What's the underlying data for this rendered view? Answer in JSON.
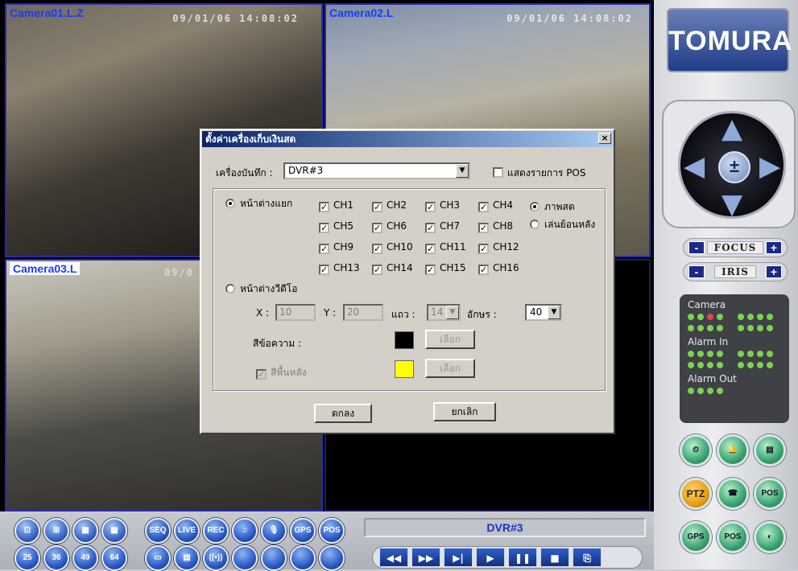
{
  "cameras": [
    {
      "label": "Camera01.L.Z",
      "timestamp": "09/01/06 14:08:02"
    },
    {
      "label": "Camera02.L",
      "timestamp": "09/01/06 14:08:02"
    },
    {
      "label": "Camera03.L",
      "timestamp": "09/0"
    }
  ],
  "brand": {
    "logo": "TOMURA"
  },
  "ptz": {
    "focus": "FOCUS",
    "iris": "IRIS",
    "minus": "-",
    "plus": "+",
    "center": "±"
  },
  "status": {
    "camera": "Camera",
    "alarm_in": "Alarm In",
    "alarm_out": "Alarm Out",
    "active_camera_index": 2
  },
  "dvr_bar": "DVR#3",
  "layout_buttons": [
    "⊡",
    "⊞",
    "▦",
    "▩",
    "25",
    "36",
    "49",
    "64"
  ],
  "func_buttons": [
    "SEQ",
    "LIVE",
    "REC",
    "♫",
    "🎙",
    "GPS",
    "POS",
    "▭",
    "▤",
    "((•))",
    "",
    "",
    "",
    ""
  ],
  "right_buttons": [
    "",
    "",
    "",
    "PTZ",
    "",
    "POS",
    "GPS",
    "POS",
    ""
  ],
  "playback": [
    "◀◀",
    "▶▶",
    "▶|",
    "▶",
    "❚❚",
    "■",
    "⎘"
  ],
  "dialog": {
    "title": "ตั้งค่าเครื่องเก็บเงินสด",
    "close": "×",
    "recorder_label": "เครื่องบันทึก :",
    "recorder_value": "DVR#3",
    "show_pos_label": "แสดงรายการ POS",
    "split_label": "หน้าต่างแยก",
    "channels": [
      "CH1",
      "CH2",
      "CH3",
      "CH4",
      "CH5",
      "CH6",
      "CH7",
      "CH8",
      "CH9",
      "CH10",
      "CH11",
      "CH12",
      "CH13",
      "CH14",
      "CH15",
      "CH16"
    ],
    "live_label": "ภาพสด",
    "playback_label": "เล่นย้อนหลัง",
    "video_window_label": "หน้าต่างวีดีโอ",
    "x_label": "X :",
    "x_value": "10",
    "y_label": "Y :",
    "y_value": "20",
    "row_label": "แถว :",
    "row_value": "14",
    "char_label": "อักษร :",
    "char_value": "40",
    "text_color_label": "สีข้อความ :",
    "bg_label": "สีพื้นหลัง",
    "choose": "เลือก",
    "text_color": "#000000",
    "bg_color": "#ffff00",
    "ok": "ตกลง",
    "cancel": "ยกเลิก"
  }
}
